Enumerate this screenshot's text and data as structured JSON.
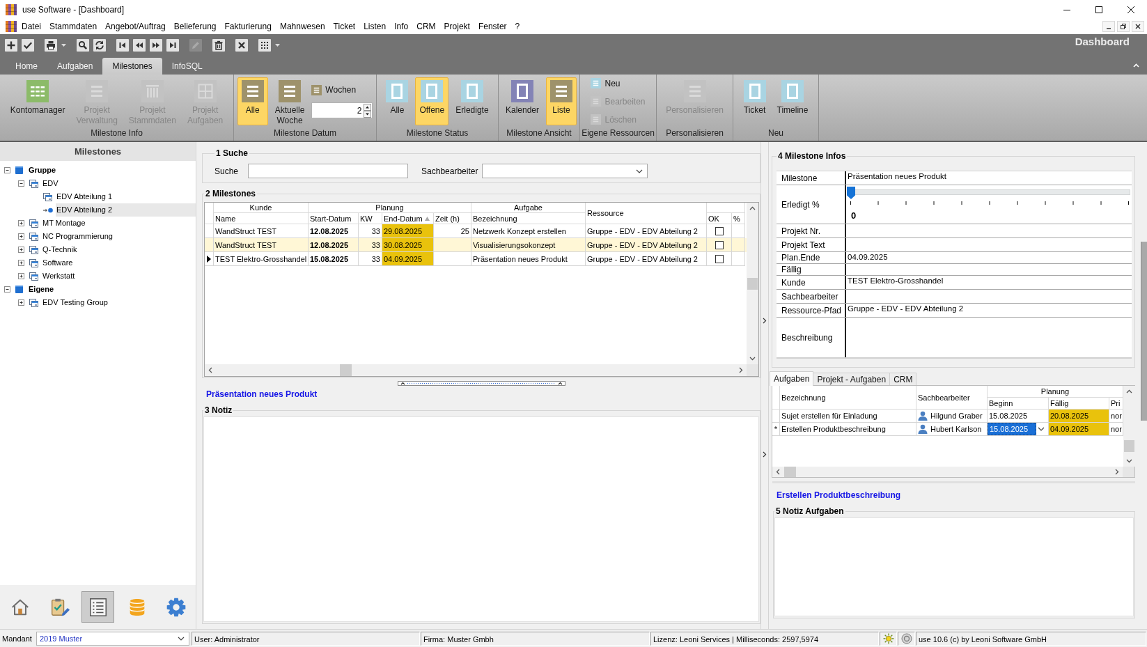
{
  "window": {
    "title": "use Software - [Dashboard]"
  },
  "menu": [
    {
      "label": "Datei"
    },
    {
      "label": "Stammdaten"
    },
    {
      "label": "Angebot/Auftrag"
    },
    {
      "label": "Belieferung"
    },
    {
      "label": "Fakturierung"
    },
    {
      "label": "Mahnwesen"
    },
    {
      "label": "Ticket"
    },
    {
      "label": "Listen"
    },
    {
      "label": "Info"
    },
    {
      "label": "CRM"
    },
    {
      "label": "Projekt"
    },
    {
      "label": "Fenster"
    },
    {
      "label": "?"
    }
  ],
  "toolbar": [
    [
      {
        "kind": "add",
        "disabled": false
      },
      {
        "kind": "save",
        "disabled": false
      }
    ],
    [
      {
        "kind": "print",
        "disabled": false
      },
      {
        "kind": "menu",
        "disabled": false
      }
    ],
    [
      {
        "kind": "search",
        "disabled": false
      },
      {
        "kind": "refresh",
        "disabled": false
      }
    ],
    [
      {
        "kind": "first",
        "disabled": false
      },
      {
        "kind": "prev",
        "disabled": false
      },
      {
        "kind": "next",
        "disabled": false
      },
      {
        "kind": "last",
        "disabled": false
      }
    ],
    [
      {
        "kind": "edit",
        "disabled": true
      }
    ],
    [
      {
        "kind": "delete",
        "disabled": false
      }
    ],
    [
      {
        "kind": "cancel",
        "disabled": false
      }
    ],
    [
      {
        "kind": "grid",
        "disabled": false
      },
      {
        "kind": "menu",
        "disabled": false
      }
    ]
  ],
  "page_title": "Dashboard",
  "ribbon_tabs": [
    {
      "label": "Home",
      "selected": false
    },
    {
      "label": "Aufgaben",
      "selected": false
    },
    {
      "label": "Milestones",
      "selected": true
    },
    {
      "label": "InfoSQL",
      "selected": false
    }
  ],
  "ribbon_groups": [
    {
      "label": "Milestone Info",
      "items": [
        {
          "kind": "large",
          "label": "Kontomanager",
          "disabled": false,
          "selected": false
        },
        {
          "kind": "large",
          "label": "Projekt Verwaltung",
          "disabled": true,
          "selected": false
        },
        {
          "kind": "large",
          "label": "Projekt Stammdaten",
          "disabled": true,
          "selected": false
        },
        {
          "kind": "large",
          "label": "Projekt Aufgaben",
          "disabled": true,
          "selected": false
        }
      ]
    },
    {
      "label": "Milestone Datum",
      "items": [
        {
          "kind": "large",
          "label": "Alle",
          "disabled": false,
          "selected": true
        },
        {
          "kind": "large",
          "label": "Aktuelle Woche",
          "disabled": false,
          "selected": false
        },
        {
          "kind": "small",
          "label": "Wochen",
          "disabled": false,
          "selected": false
        },
        {
          "kind": "spinner",
          "value": "2"
        }
      ]
    },
    {
      "label": "Milestone Status",
      "items": [
        {
          "kind": "large",
          "label": "Alle",
          "disabled": false,
          "selected": false
        },
        {
          "kind": "large",
          "label": "Offene",
          "disabled": false,
          "selected": true
        },
        {
          "kind": "large",
          "label": "Erledigte",
          "disabled": false,
          "selected": false
        }
      ]
    },
    {
      "label": "Milestone Ansicht",
      "items": [
        {
          "kind": "large",
          "label": "Kalender",
          "disabled": false,
          "selected": false
        },
        {
          "kind": "large",
          "label": "Liste",
          "disabled": false,
          "selected": true
        }
      ]
    },
    {
      "label": "Eigene Ressourcen",
      "items": [
        {
          "kind": "small",
          "label": "Neu",
          "disabled": false,
          "selected": false
        },
        {
          "kind": "small",
          "label": "Bearbeiten",
          "disabled": true,
          "selected": false
        },
        {
          "kind": "small",
          "label": "Löschen",
          "disabled": true,
          "selected": false
        }
      ]
    },
    {
      "label": "Personalisieren",
      "items": [
        {
          "kind": "large",
          "label": "Personalisieren",
          "disabled": true,
          "selected": false
        }
      ]
    },
    {
      "label": "Neu",
      "items": [
        {
          "kind": "large",
          "label": "Ticket",
          "disabled": false,
          "selected": false
        },
        {
          "kind": "large",
          "label": "Timeline",
          "disabled": false,
          "selected": false
        }
      ]
    }
  ],
  "sidebar": {
    "title": "Milestones",
    "tree": [
      {
        "label": "Gruppe",
        "kind": "root",
        "expanded": true,
        "selected": false,
        "children": [
          {
            "label": "EDV",
            "kind": "group",
            "expanded": true,
            "selected": false,
            "children": [
              {
                "label": "EDV Abteilung 1",
                "kind": "group",
                "selected": false
              },
              {
                "label": "EDV Abteilung 2",
                "kind": "group",
                "selected": true
              }
            ]
          },
          {
            "label": "MT Montage",
            "kind": "group",
            "expanded": false,
            "selected": false
          },
          {
            "label": "NC Programmierung",
            "kind": "group",
            "expanded": false,
            "selected": false
          },
          {
            "label": "Q-Technik",
            "kind": "group",
            "expanded": false,
            "selected": false
          },
          {
            "label": "Software",
            "kind": "group",
            "expanded": false,
            "selected": false
          },
          {
            "label": "Werkstatt",
            "kind": "group",
            "expanded": false,
            "selected": false
          }
        ]
      },
      {
        "label": "Eigene",
        "kind": "root",
        "expanded": true,
        "selected": false,
        "children": [
          {
            "label": "EDV Testing Group",
            "kind": "group",
            "expanded": false,
            "selected": false
          }
        ]
      }
    ],
    "nav": [
      {
        "kind": "home",
        "selected": false
      },
      {
        "kind": "tasks",
        "selected": false
      },
      {
        "kind": "list",
        "selected": true
      },
      {
        "kind": "database",
        "selected": false
      },
      {
        "kind": "settings",
        "selected": false
      }
    ]
  },
  "search": {
    "title": "1 Suche",
    "fields": [
      {
        "kind": "text",
        "label": "Suche"
      },
      {
        "kind": "dropdown",
        "label": "Sachbearbeiter"
      }
    ]
  },
  "milestones": {
    "title": "2 Milestones",
    "header_groups": [
      {
        "label": "Kunde",
        "columns": [
          {
            "label": "Name"
          }
        ]
      },
      {
        "label": "Planung",
        "columns": [
          {
            "label": "Start-Datum"
          },
          {
            "label": "KW"
          },
          {
            "label": "End-Datum",
            "sorted": true
          },
          {
            "label": "Zeit (h)"
          }
        ]
      },
      {
        "label": "Aufgabe",
        "columns": [
          {
            "label": "Bezeichnung"
          }
        ]
      },
      {
        "label": "Ressource"
      },
      {
        "columns": [
          {
            "label": "OK"
          },
          {
            "label": "%"
          }
        ]
      }
    ],
    "rows": [
      {
        "current": false,
        "name": "WandStruct TEST",
        "start": "12.08.2025",
        "week": "33",
        "end": "29.08.2025",
        "flagged": true,
        "hours": "25",
        "task": "Netzwerk Konzept erstellen",
        "resource": "Gruppe - EDV - EDV Abteilung 2",
        "ok": false
      },
      {
        "current": false,
        "name": "WandStruct TEST",
        "start": "12.08.2025",
        "week": "33",
        "end": "30.08.2025",
        "flagged": true,
        "task": "Visualisierungsokonzept",
        "resource": "Gruppe - EDV - EDV Abteilung 2",
        "ok": false
      },
      {
        "current": true,
        "name": "TEST Elektro-Grosshandel",
        "start": "15.08.2025",
        "week": "33",
        "end": "04.09.2025",
        "flagged": true,
        "task": "Präsentation neues Produkt",
        "resource": "Gruppe - EDV - EDV Abteilung 2",
        "ok": false
      }
    ],
    "selected_title": "Präsentation neues Produkt"
  },
  "notes": {
    "title": "3 Notiz"
  },
  "info": {
    "title": "4 Milestone Infos",
    "fields": [
      {
        "kind": "text",
        "label": "Milestone",
        "value": "Präsentation neues Produkt"
      },
      {
        "kind": "slider",
        "label": "Erledigt %",
        "level": 0,
        "reading": "0"
      },
      {
        "kind": "text",
        "label": "Projekt Nr."
      },
      {
        "kind": "text",
        "label": "Projekt Text"
      },
      {
        "kind": "date",
        "label": "Plan.Ende",
        "value": "04.09.2025"
      },
      {
        "kind": "date",
        "label": "Fällig"
      },
      {
        "kind": "text",
        "label": "Kunde",
        "value": "TEST Elektro-Grosshandel"
      },
      {
        "kind": "text",
        "label": "Sachbearbeiter"
      },
      {
        "kind": "text",
        "label": "Ressource-Pfad",
        "value": "Gruppe - EDV - EDV Abteilung 2"
      },
      {
        "kind": "memo",
        "label": "Beschreibung"
      }
    ]
  },
  "detail_tabs": [
    {
      "label": "Aufgaben",
      "selected": true
    },
    {
      "label": "Projekt - Aufgaben",
      "selected": false
    },
    {
      "label": "CRM",
      "selected": false
    }
  ],
  "tasks": {
    "header_groups": [
      {
        "label": "Bezeichnung"
      },
      {
        "label": "Sachbearbeiter"
      },
      {
        "label": "Planung",
        "columns": [
          {
            "label": "Beginn"
          },
          {
            "label": "Fällig"
          },
          {
            "label": "Pri"
          }
        ]
      }
    ],
    "rows": [
      {
        "task": "Sujet erstellen für Einladung",
        "assignee": "Hilgund Graber",
        "start": "15.08.2025",
        "due": "20.08.2025",
        "flagged": true,
        "priority": "nor",
        "editing": false
      },
      {
        "marker": "*",
        "task": "Erstellen Produktbeschreibung",
        "assignee": "Hubert Karlson",
        "start": "15.08.2025",
        "due": "04.09.2025",
        "flagged": true,
        "priority": "nor",
        "editing": true
      }
    ],
    "selected_title": "Erstellen Produktbeschreibung"
  },
  "task_notes": {
    "title": "5 Notiz Aufgaben"
  },
  "status_bar": {
    "mandant_label": "Mandant",
    "mandant": "2019 Muster",
    "user": "User: Administrator",
    "company": "Firma: Muster Gmbh",
    "license": "Lizenz: Leoni Services | Milliseconds: 2597,5974",
    "version": "use 10.6 (c) by Leoni Software GmbH"
  }
}
